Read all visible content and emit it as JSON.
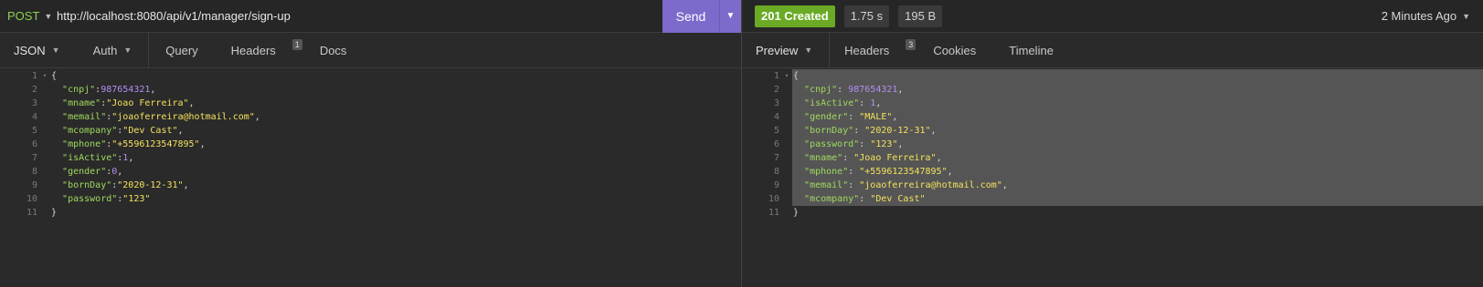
{
  "request": {
    "method": "POST",
    "url": "http://localhost:8080/api/v1/manager/sign-up",
    "send_label": "Send",
    "tabs": [
      {
        "label": "JSON",
        "has_caret": true
      },
      {
        "label": "Auth",
        "has_caret": true
      },
      {
        "label": "Query"
      },
      {
        "label": "Headers",
        "count": "1"
      },
      {
        "label": "Docs"
      }
    ],
    "body_lines": [
      [
        [
          "p",
          "{"
        ]
      ],
      [
        [
          "p",
          "  "
        ],
        [
          "k",
          "\"cnpj\""
        ],
        [
          "p",
          ":"
        ],
        [
          "n",
          "987654321"
        ],
        [
          "p",
          ","
        ]
      ],
      [
        [
          "p",
          "  "
        ],
        [
          "k",
          "\"mname\""
        ],
        [
          "p",
          ":"
        ],
        [
          "s",
          "\"Joao Ferreira\""
        ],
        [
          "p",
          ","
        ]
      ],
      [
        [
          "p",
          "  "
        ],
        [
          "k",
          "\"memail\""
        ],
        [
          "p",
          ":"
        ],
        [
          "s",
          "\"joaoferreira@hotmail.com\""
        ],
        [
          "p",
          ","
        ]
      ],
      [
        [
          "p",
          "  "
        ],
        [
          "k",
          "\"mcompany\""
        ],
        [
          "p",
          ":"
        ],
        [
          "s",
          "\"Dev Cast\""
        ],
        [
          "p",
          ","
        ]
      ],
      [
        [
          "p",
          "  "
        ],
        [
          "k",
          "\"mphone\""
        ],
        [
          "p",
          ":"
        ],
        [
          "s",
          "\"+5596123547895\""
        ],
        [
          "p",
          ","
        ]
      ],
      [
        [
          "p",
          "  "
        ],
        [
          "k",
          "\"isActive\""
        ],
        [
          "p",
          ":"
        ],
        [
          "n",
          "1"
        ],
        [
          "p",
          ","
        ]
      ],
      [
        [
          "p",
          "  "
        ],
        [
          "k",
          "\"gender\""
        ],
        [
          "p",
          ":"
        ],
        [
          "n",
          "0"
        ],
        [
          "p",
          ","
        ]
      ],
      [
        [
          "p",
          "  "
        ],
        [
          "k",
          "\"bornDay\""
        ],
        [
          "p",
          ":"
        ],
        [
          "s",
          "\"2020-12-31\""
        ],
        [
          "p",
          ","
        ]
      ],
      [
        [
          "p",
          "  "
        ],
        [
          "k",
          "\"password\""
        ],
        [
          "p",
          ":"
        ],
        [
          "s",
          "\"123\""
        ]
      ],
      [
        [
          "p",
          "}"
        ]
      ]
    ]
  },
  "response": {
    "status": "201 Created",
    "time": "1.75 s",
    "size": "195 B",
    "ago": "2 Minutes Ago",
    "tabs": [
      {
        "label": "Preview",
        "has_caret": true
      },
      {
        "label": "Headers",
        "count": "3"
      },
      {
        "label": "Cookies"
      },
      {
        "label": "Timeline"
      }
    ],
    "body_lines": [
      [
        [
          "p",
          "{"
        ]
      ],
      [
        [
          "p",
          "  "
        ],
        [
          "k",
          "\"cnpj\""
        ],
        [
          "p",
          ": "
        ],
        [
          "n",
          "987654321"
        ],
        [
          "p",
          ","
        ]
      ],
      [
        [
          "p",
          "  "
        ],
        [
          "k",
          "\"isActive\""
        ],
        [
          "p",
          ": "
        ],
        [
          "n",
          "1"
        ],
        [
          "p",
          ","
        ]
      ],
      [
        [
          "p",
          "  "
        ],
        [
          "k",
          "\"gender\""
        ],
        [
          "p",
          ": "
        ],
        [
          "s",
          "\"MALE\""
        ],
        [
          "p",
          ","
        ]
      ],
      [
        [
          "p",
          "  "
        ],
        [
          "k",
          "\"bornDay\""
        ],
        [
          "p",
          ": "
        ],
        [
          "s",
          "\"2020-12-31\""
        ],
        [
          "p",
          ","
        ]
      ],
      [
        [
          "p",
          "  "
        ],
        [
          "k",
          "\"password\""
        ],
        [
          "p",
          ": "
        ],
        [
          "s",
          "\"123\""
        ],
        [
          "p",
          ","
        ]
      ],
      [
        [
          "p",
          "  "
        ],
        [
          "k",
          "\"mname\""
        ],
        [
          "p",
          ": "
        ],
        [
          "s",
          "\"Joao Ferreira\""
        ],
        [
          "p",
          ","
        ]
      ],
      [
        [
          "p",
          "  "
        ],
        [
          "k",
          "\"mphone\""
        ],
        [
          "p",
          ": "
        ],
        [
          "s",
          "\"+5596123547895\""
        ],
        [
          "p",
          ","
        ]
      ],
      [
        [
          "p",
          "  "
        ],
        [
          "k",
          "\"memail\""
        ],
        [
          "p",
          ": "
        ],
        [
          "s",
          "\"joaoferreira@hotmail.com\""
        ],
        [
          "p",
          ","
        ]
      ],
      [
        [
          "p",
          "  "
        ],
        [
          "k",
          "\"mcompany\""
        ],
        [
          "p",
          ": "
        ],
        [
          "s",
          "\"Dev Cast\""
        ]
      ],
      [
        [
          "p",
          "}"
        ]
      ]
    ]
  },
  "colors": {
    "method": "#8fd14f",
    "send": "#7e6acb",
    "status_ok": "#6aaa25",
    "key": "#9fd95f",
    "string": "#f4e25c",
    "number": "#b28ef0"
  },
  "icons": [
    "caret-down-icon",
    "fold-arrow-icon"
  ]
}
